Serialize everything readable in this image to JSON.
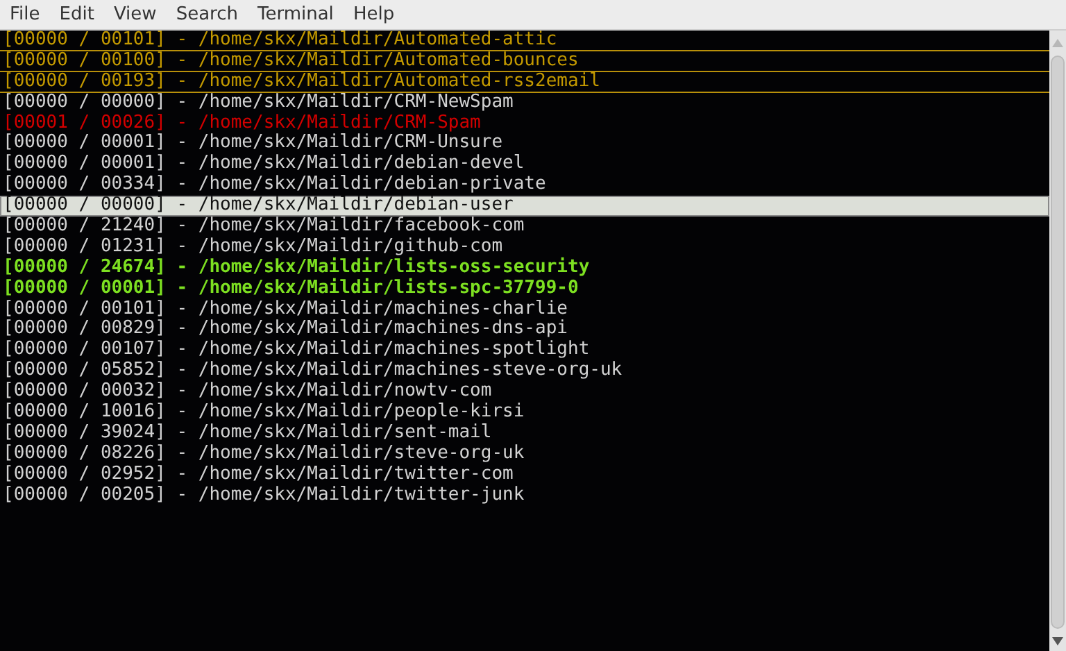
{
  "menu": [
    "File",
    "Edit",
    "View",
    "Search",
    "Terminal",
    "Help"
  ],
  "rows": [
    {
      "text": "[00000 / 00101] - /home/skx/Maildir/Automated-attic",
      "kind": "automated",
      "selected": false
    },
    {
      "text": "[00000 / 00100] - /home/skx/Maildir/Automated-bounces",
      "kind": "automated",
      "selected": false
    },
    {
      "text": "[00000 / 00193] - /home/skx/Maildir/Automated-rss2email",
      "kind": "automated",
      "selected": false
    },
    {
      "text": "[00000 / 00000] - /home/skx/Maildir/CRM-NewSpam",
      "kind": "normal",
      "selected": false
    },
    {
      "text": "[00001 / 00026] - /home/skx/Maildir/CRM-Spam",
      "kind": "spam",
      "selected": false
    },
    {
      "text": "[00000 / 00001] - /home/skx/Maildir/CRM-Unsure",
      "kind": "normal",
      "selected": false
    },
    {
      "text": "[00000 / 00001] - /home/skx/Maildir/debian-devel",
      "kind": "normal",
      "selected": false
    },
    {
      "text": "[00000 / 00334] - /home/skx/Maildir/debian-private",
      "kind": "normal",
      "selected": false
    },
    {
      "text": "[00000 / 00000] - /home/skx/Maildir/debian-user",
      "kind": "normal",
      "selected": true
    },
    {
      "text": "[00000 / 21240] - /home/skx/Maildir/facebook-com",
      "kind": "normal",
      "selected": false
    },
    {
      "text": "[00000 / 01231] - /home/skx/Maildir/github-com",
      "kind": "normal",
      "selected": false
    },
    {
      "text": "[00000 / 24674] - /home/skx/Maildir/lists-oss-security",
      "kind": "list",
      "selected": false
    },
    {
      "text": "[00000 / 00001] - /home/skx/Maildir/lists-spc-37799-0",
      "kind": "list",
      "selected": false
    },
    {
      "text": "[00000 / 00101] - /home/skx/Maildir/machines-charlie",
      "kind": "normal",
      "selected": false
    },
    {
      "text": "[00000 / 00829] - /home/skx/Maildir/machines-dns-api",
      "kind": "normal",
      "selected": false
    },
    {
      "text": "[00000 / 00107] - /home/skx/Maildir/machines-spotlight",
      "kind": "normal",
      "selected": false
    },
    {
      "text": "[00000 / 05852] - /home/skx/Maildir/machines-steve-org-uk",
      "kind": "normal",
      "selected": false
    },
    {
      "text": "[00000 / 00032] - /home/skx/Maildir/nowtv-com",
      "kind": "normal",
      "selected": false
    },
    {
      "text": "[00000 / 10016] - /home/skx/Maildir/people-kirsi",
      "kind": "normal",
      "selected": false
    },
    {
      "text": "[00000 / 39024] - /home/skx/Maildir/sent-mail",
      "kind": "normal",
      "selected": false
    },
    {
      "text": "[00000 / 08226] - /home/skx/Maildir/steve-org-uk",
      "kind": "normal",
      "selected": false
    },
    {
      "text": "[00000 / 02952] - /home/skx/Maildir/twitter-com",
      "kind": "normal",
      "selected": false
    },
    {
      "text": "[00000 / 00205] - /home/skx/Maildir/twitter-junk",
      "kind": "normal",
      "selected": false
    }
  ]
}
